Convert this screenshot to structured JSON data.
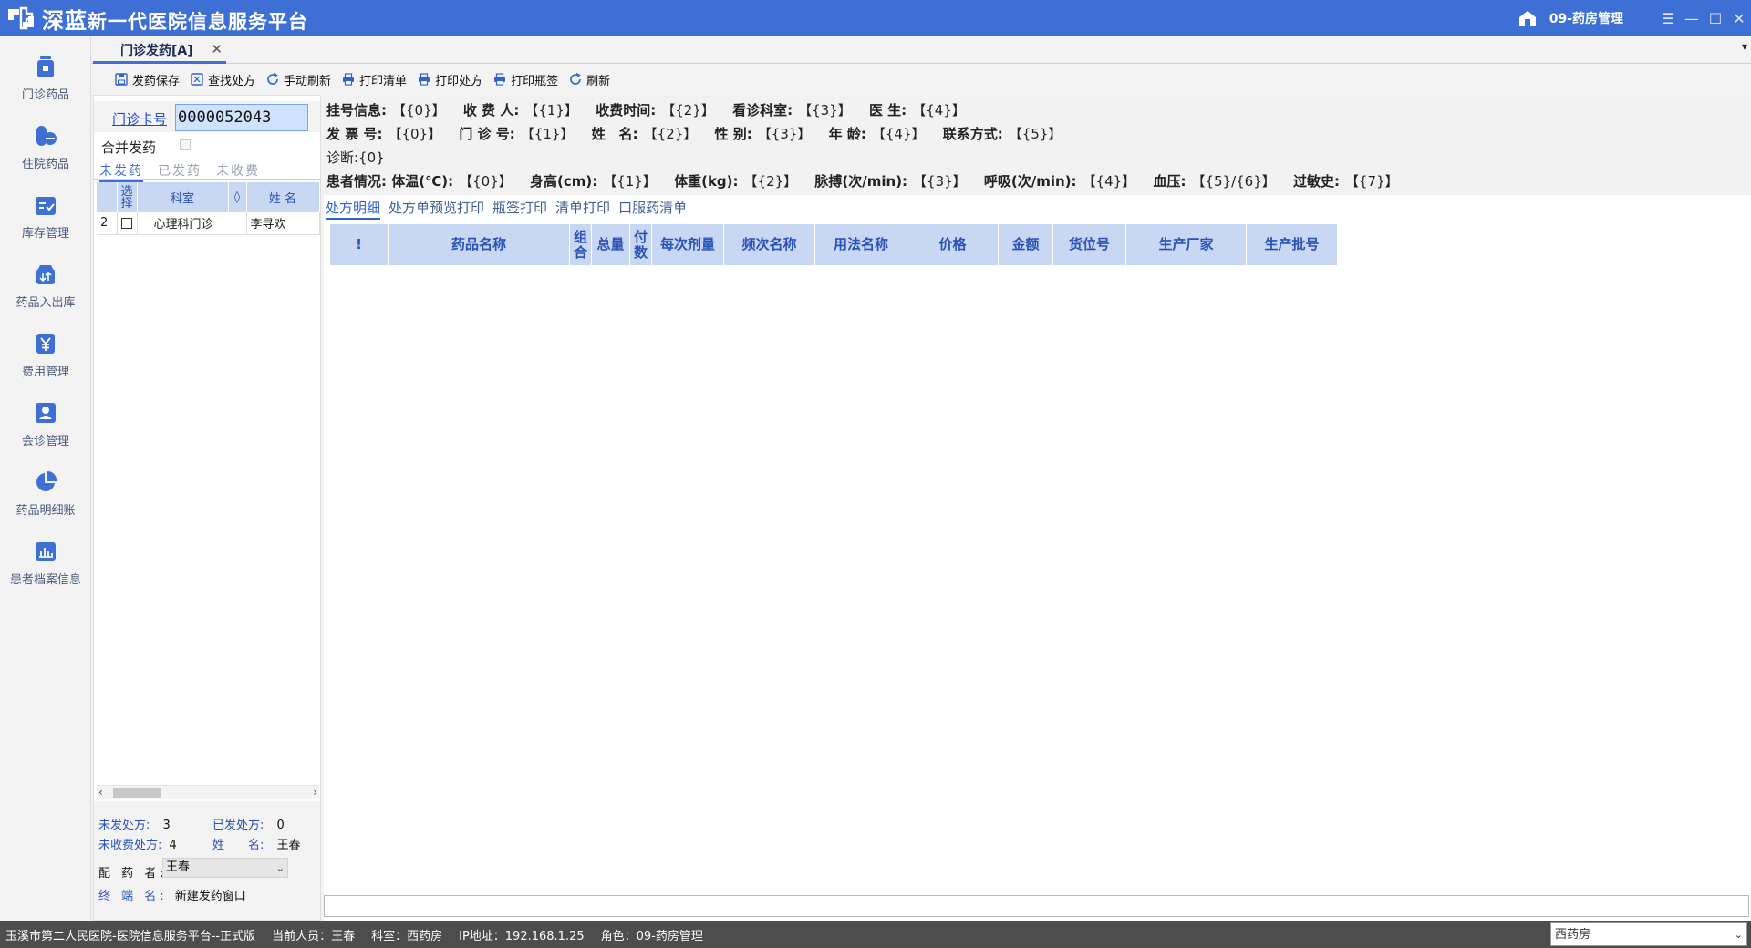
{
  "app": {
    "title_prefix": "深蓝",
    "title_rest": "新一代医院信息服务平台",
    "role_badge": "09-药房管理",
    "colors": {
      "primary": "#3d6fd4",
      "header_bg": "#c8d7f2",
      "statusbar": "#4d4d4d"
    }
  },
  "window_controls": {
    "menu": "☰",
    "minimize": "—",
    "maximize": "☐",
    "close": "✕"
  },
  "nav": [
    {
      "label": "门诊药品",
      "icon": "pill-bottle-icon"
    },
    {
      "label": "住院药品",
      "icon": "capsule-icon"
    },
    {
      "label": "库存管理",
      "icon": "inventory-icon"
    },
    {
      "label": "药品入出库",
      "icon": "stock-transfer-icon"
    },
    {
      "label": "费用管理",
      "icon": "yuan-icon"
    },
    {
      "label": "会诊管理",
      "icon": "person-icon"
    },
    {
      "label": "药品明细账",
      "icon": "pie-chart-icon"
    },
    {
      "label": "患者档案信息",
      "icon": "bar-chart-icon"
    }
  ],
  "tab": {
    "label": "门诊发药[A]",
    "close": "✕",
    "menu": "▾"
  },
  "toolbar": [
    {
      "label": "发药保存",
      "icon": "save-icon"
    },
    {
      "label": "查找处方",
      "icon": "search-doc-icon"
    },
    {
      "label": "手动刷新",
      "icon": "refresh-icon"
    },
    {
      "label": "打印清单",
      "icon": "printer-icon"
    },
    {
      "label": "打印处方",
      "icon": "printer-icon"
    },
    {
      "label": "打印瓶签",
      "icon": "printer-icon"
    },
    {
      "label": "刷新",
      "icon": "refresh-icon"
    }
  ],
  "card": {
    "link": "门诊卡号",
    "value": "0000052043"
  },
  "merge_label": "合并发药",
  "subtabs": [
    "未发药",
    "已发药",
    "未收费"
  ],
  "patient_table": {
    "headers": {
      "select": "选择",
      "dept": "科室",
      "sort": "◊",
      "name": "姓 名"
    },
    "rows": [
      {
        "no": "2",
        "dept": "心理科门诊",
        "name": "李寻欢"
      }
    ]
  },
  "scroll": {
    "left": "‹",
    "right": "›"
  },
  "stats": {
    "undispensed_label": "未发处方:",
    "undispensed_value": "3",
    "dispensed_label": "已发处方:",
    "dispensed_value": "0",
    "unpaid_label": "未收费处方:",
    "unpaid_value": "4",
    "name_label": "姓　　名:",
    "name_value": "王春",
    "dispenser_label": "配 药 者:",
    "dispenser_value": "王春",
    "terminal_label": "终 端 名:",
    "terminal_value": "新建发药窗口"
  },
  "info": {
    "line1": [
      {
        "k": "挂号信息:",
        "v": "【{0}】"
      },
      {
        "k": "收 费 人:",
        "v": "【{1}】"
      },
      {
        "k": "收费时间:",
        "v": "【{2}】"
      },
      {
        "k": "看诊科室:",
        "v": "【{3}】"
      },
      {
        "k": "医 生:",
        "v": "【{4}】"
      }
    ],
    "line2": [
      {
        "k": "发 票 号:",
        "v": "【{0}】"
      },
      {
        "k": "门 诊 号:",
        "v": "【{1}】"
      },
      {
        "k": "姓　名:",
        "v": "【{2}】"
      },
      {
        "k": "性 别:",
        "v": "【{3}】"
      },
      {
        "k": "年 龄:",
        "v": "【{4}】"
      },
      {
        "k": "联系方式:",
        "v": "【{5}】"
      }
    ],
    "diagnosis": "诊断:{0}",
    "line4": [
      {
        "k": "患者情况:",
        "v": ""
      },
      {
        "k": "体温(℃):",
        "v": "【{0}】"
      },
      {
        "k": "身高(cm):",
        "v": "【{1}】"
      },
      {
        "k": "体重(kg):",
        "v": "【{2}】"
      },
      {
        "k": "脉搏(次/min):",
        "v": "【{3}】"
      },
      {
        "k": "呼吸(次/min):",
        "v": "【{4}】"
      },
      {
        "k": "血压:",
        "v": "【{5}/{6}】"
      },
      {
        "k": "过敏史:",
        "v": "【{7}】"
      }
    ]
  },
  "section_tabs": [
    "处方明细",
    "处方单预览打印",
    "瓶签打印",
    "清单打印",
    "口服药清单"
  ],
  "rx_columns": [
    "!",
    "药品名称",
    "组合",
    "总量",
    "付数",
    "每次剂量",
    "频次名称",
    "用法名称",
    "价格",
    "金额",
    "货位号",
    "生产厂家",
    "生产批号"
  ],
  "statusbar": {
    "hospital": "玉溪市第二人民医院-医院信息服务平台--正式版",
    "current_user": "当前人员：王春",
    "dept": "科室：西药房",
    "ip": "IP地址：192.168.1.25",
    "role": "角色：09-药房管理",
    "pharmacy_select": "西药房"
  }
}
